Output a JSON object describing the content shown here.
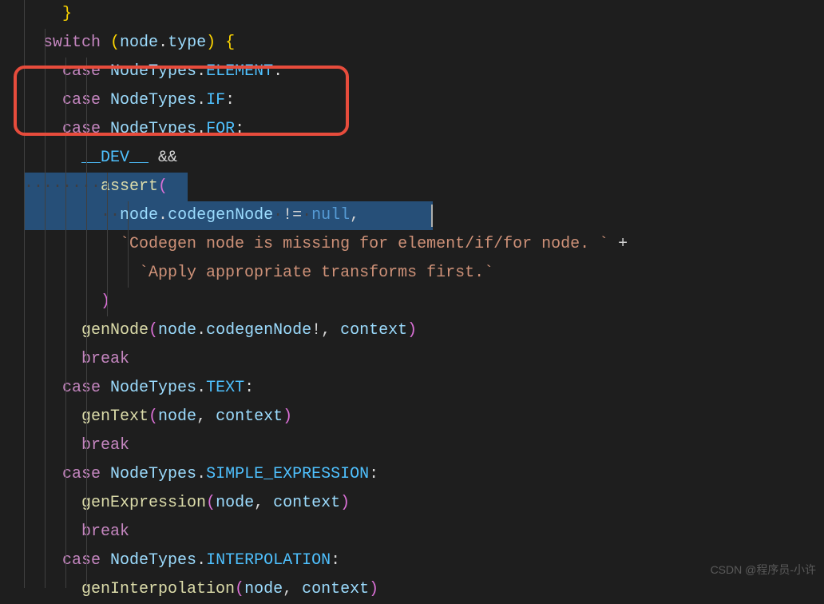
{
  "code": {
    "l0": "  }",
    "l1_switch": "switch",
    "l1_paren_o": " (",
    "l1_node": "node",
    "l1_dot": ".",
    "l1_type": "type",
    "l1_paren_c": ") ",
    "l1_brace": "{",
    "l2_case": "case",
    "l2_nt": " NodeTypes",
    "l2_dot": ".",
    "l2_elem": "ELEMENT",
    "l2_colon": ":",
    "l3_case": "case",
    "l3_nt": " NodeTypes",
    "l3_dot": ".",
    "l3_if": "IF",
    "l3_colon": ":",
    "l4_case": "case",
    "l4_nt": " NodeTypes",
    "l4_dot": ".",
    "l4_for": "FOR",
    "l4_colon": ":",
    "l5_dev": "__DEV__",
    "l5_and": " &&",
    "l6_ws": "········",
    "l6_assert": "assert",
    "l6_paren": "(",
    "l7_ws": "··",
    "l7_node": "node",
    "l7_dot": ".",
    "l7_cgn": "codegenNode",
    "l7_ws2": "·",
    "l7_neq": "!=",
    "l7_ws3": "·",
    "l7_null": "null",
    "l7_comma": ",",
    "l8_str": "`Codegen node is missing for element/if/for node. `",
    "l8_plus": " +",
    "l9_str": "`Apply appropriate transforms first.`",
    "l10_paren": ")",
    "l11_gn": "genNode",
    "l11_paren_o": "(",
    "l11_node": "node",
    "l11_dot": ".",
    "l11_cgn": "codegenNode",
    "l11_bang": "!",
    "l11_comma": ", ",
    "l11_ctx": "context",
    "l11_paren_c": ")",
    "l12_break": "break",
    "l13_case": "case",
    "l13_nt": " NodeTypes",
    "l13_dot": ".",
    "l13_text": "TEXT",
    "l13_colon": ":",
    "l14_gt": "genText",
    "l14_paren_o": "(",
    "l14_node": "node",
    "l14_comma": ", ",
    "l14_ctx": "context",
    "l14_paren_c": ")",
    "l15_break": "break",
    "l16_case": "case",
    "l16_nt": " NodeTypes",
    "l16_dot": ".",
    "l16_se": "SIMPLE_EXPRESSION",
    "l16_colon": ":",
    "l17_ge": "genExpression",
    "l17_paren_o": "(",
    "l17_node": "node",
    "l17_comma": ", ",
    "l17_ctx": "context",
    "l17_paren_c": ")",
    "l18_break": "break",
    "l19_case": "case",
    "l19_nt": " NodeTypes",
    "l19_dot": ".",
    "l19_interp": "INTERPOLATION",
    "l19_colon": ":",
    "l20_gi": "genInterpolation",
    "l20_paren_o": "(",
    "l20_node": "node",
    "l20_comma": ", ",
    "l20_ctx": "context",
    "l20_paren_c": ")"
  },
  "watermark": "CSDN @程序员-小许"
}
